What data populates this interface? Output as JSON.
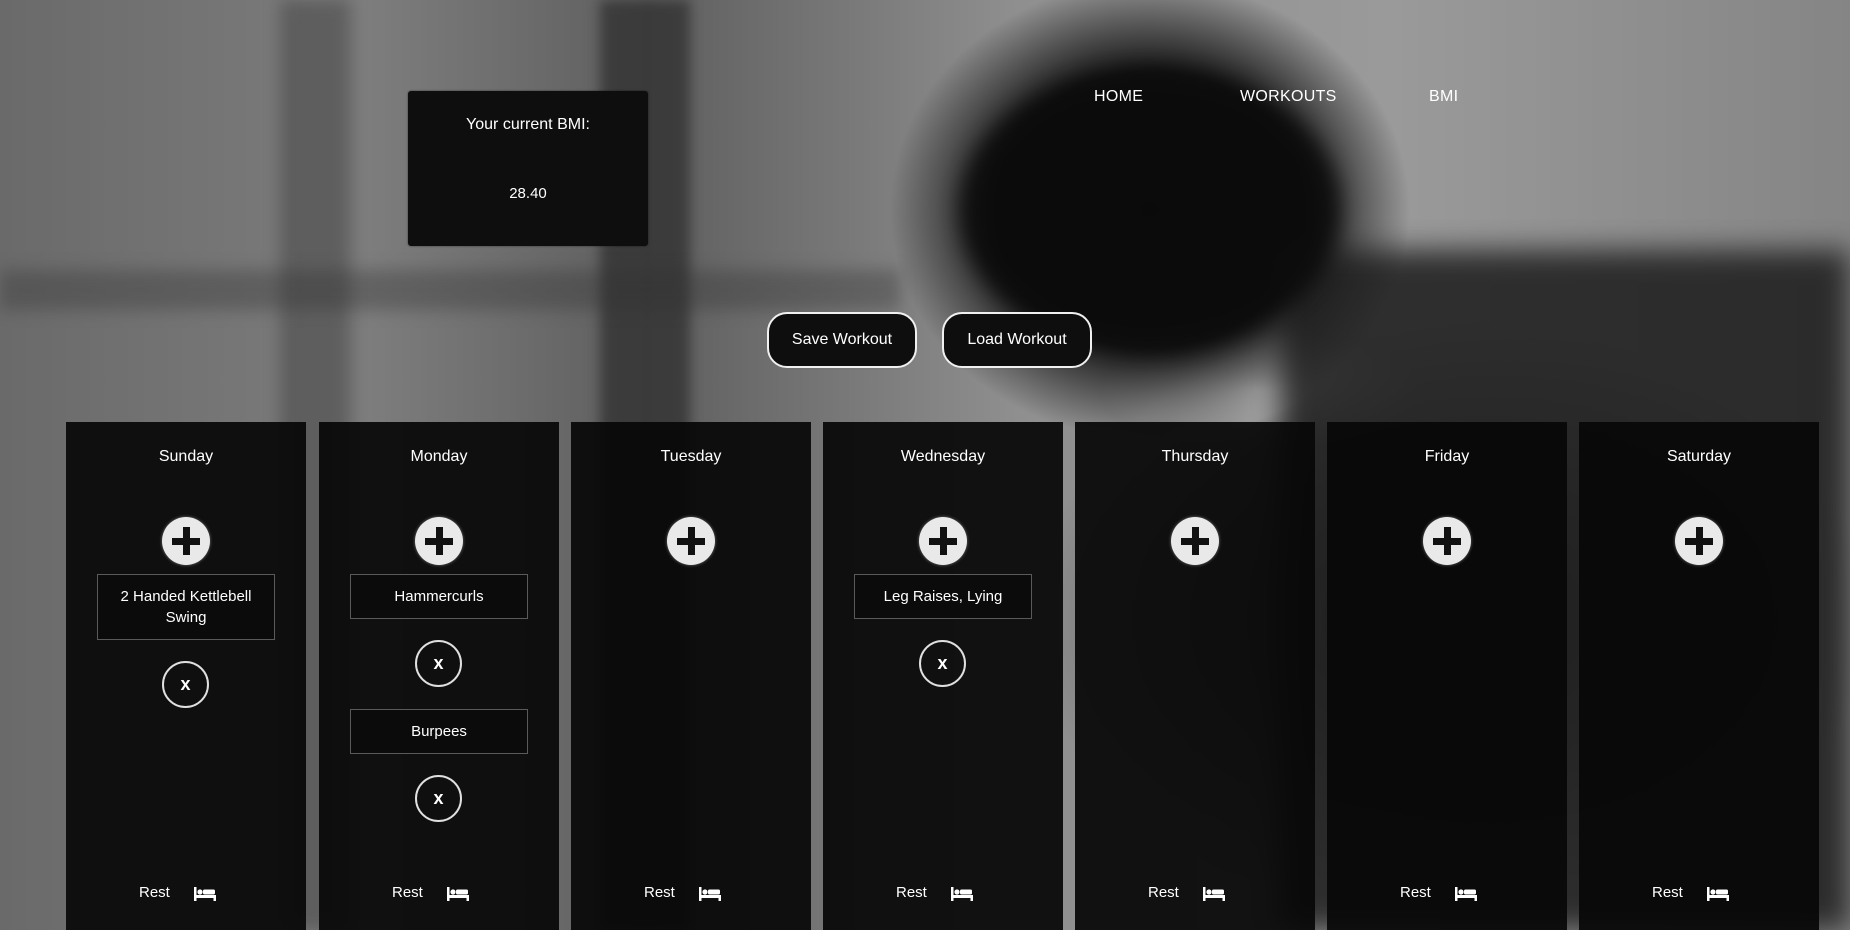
{
  "bmi": {
    "label": "Your current BMI:",
    "value": "28.40"
  },
  "nav": {
    "home": "HOME",
    "workouts": "WORKOUTS",
    "bmi": "BMI"
  },
  "actions": {
    "save": "Save Workout",
    "load": "Load Workout"
  },
  "rest_label": "Rest",
  "remove_label": "x",
  "days": [
    {
      "name": "Sunday",
      "exercises": [
        "2 Handed Kettlebell Swing"
      ]
    },
    {
      "name": "Monday",
      "exercises": [
        "Hammercurls",
        "Burpees"
      ]
    },
    {
      "name": "Tuesday",
      "exercises": []
    },
    {
      "name": "Wednesday",
      "exercises": [
        "Leg Raises, Lying"
      ]
    },
    {
      "name": "Thursday",
      "exercises": []
    },
    {
      "name": "Friday",
      "exercises": []
    },
    {
      "name": "Saturday",
      "exercises": []
    }
  ],
  "icons": {
    "add": "plus-icon",
    "remove": "close-icon",
    "rest": "bed-icon"
  }
}
